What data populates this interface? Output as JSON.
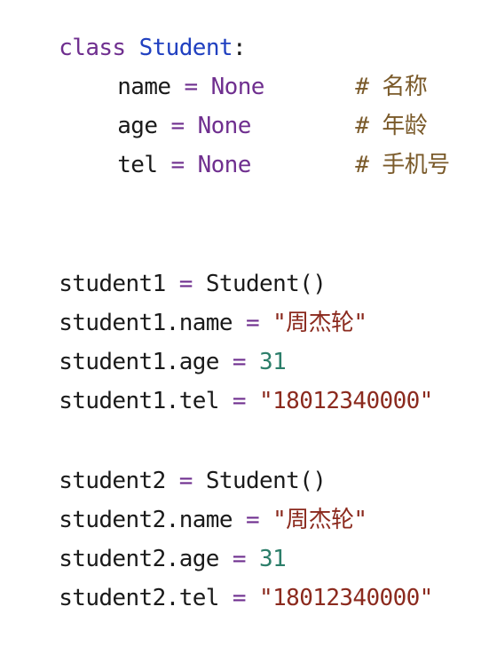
{
  "code": {
    "line1": {
      "keyword": "class",
      "class_name": "Student",
      "colon": ":"
    },
    "attrs": [
      {
        "name": "name",
        "eq": "=",
        "value": "None",
        "comment_hash": "#",
        "comment": "名称"
      },
      {
        "name": "age",
        "eq": "=",
        "value": "None",
        "comment_hash": "#",
        "comment": "年龄"
      },
      {
        "name": "tel",
        "eq": "=",
        "value": "None",
        "comment_hash": "#",
        "comment": "手机号"
      }
    ],
    "student1": {
      "create": {
        "var": "student1",
        "eq": "=",
        "call": "Student()"
      },
      "name": {
        "target": "student1.name",
        "eq": "=",
        "value": "\"周杰轮\""
      },
      "age": {
        "target": "student1.age",
        "eq": "=",
        "value": "31"
      },
      "tel": {
        "target": "student1.tel",
        "eq": "=",
        "value": "\"18012340000\""
      }
    },
    "student2": {
      "create": {
        "var": "student2",
        "eq": "=",
        "call": "Student()"
      },
      "name": {
        "target": "student2.name",
        "eq": "=",
        "value": "\"周杰轮\""
      },
      "age": {
        "target": "student2.age",
        "eq": "=",
        "value": "31"
      },
      "tel": {
        "target": "student2.tel",
        "eq": "=",
        "value": "\"18012340000\""
      }
    }
  },
  "colors": {
    "keyword": "#6f2f8f",
    "class_name": "#2040c0",
    "string": "#8b2a1e",
    "number": "#2c7e6a",
    "comment": "#7a5a2a",
    "identifier": "#1a1a1a"
  }
}
